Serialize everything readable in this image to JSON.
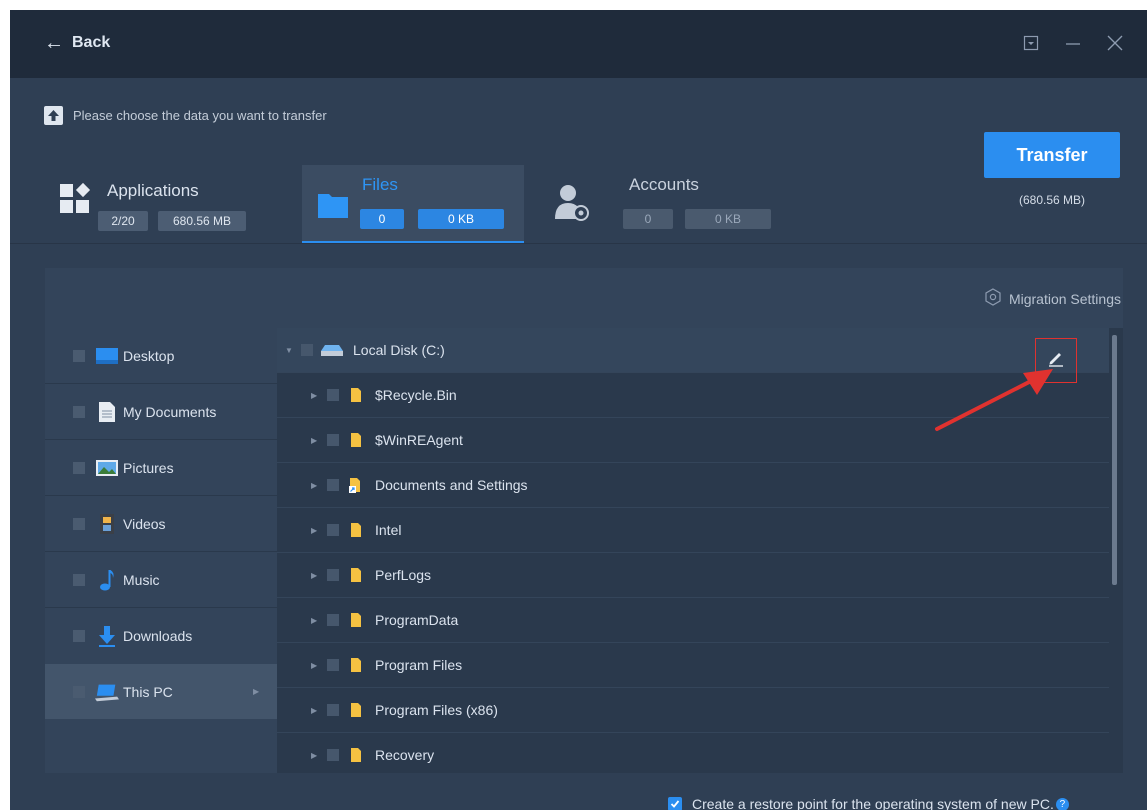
{
  "titlebar": {
    "back_label": "Back"
  },
  "header": {
    "hint": "Please choose the data you want to transfer",
    "tabs": [
      {
        "label": "Applications",
        "count": "2/20",
        "size": "680.56 MB"
      },
      {
        "label": "Files",
        "count": "0",
        "size": "0 KB"
      },
      {
        "label": "Accounts",
        "count": "0",
        "size": "0 KB"
      }
    ],
    "transfer_label": "Transfer",
    "transfer_size": "(680.56 MB)"
  },
  "panel": {
    "migration_settings": "Migration Settings",
    "sidebar": [
      {
        "label": "Desktop",
        "icon": "desktop-icon"
      },
      {
        "label": "My Documents",
        "icon": "documents-icon"
      },
      {
        "label": "Pictures",
        "icon": "pictures-icon"
      },
      {
        "label": "Videos",
        "icon": "videos-icon"
      },
      {
        "label": "Music",
        "icon": "music-icon"
      },
      {
        "label": "Downloads",
        "icon": "downloads-icon"
      },
      {
        "label": "This PC",
        "icon": "this-pc-icon",
        "selected": true
      }
    ],
    "tree": {
      "root": "Local Disk (C:)",
      "folders": [
        "$Recycle.Bin",
        "$WinREAgent",
        "Documents and Settings",
        "Intel",
        "PerfLogs",
        "ProgramData",
        "Program Files",
        "Program Files (x86)",
        "Recovery"
      ]
    }
  },
  "footer": {
    "restore_label": "Create a restore point for the operating system of new PC.",
    "restore_checked": true
  },
  "colors": {
    "accent": "#2b8ef0",
    "window_bg": "#2f3f54",
    "titlebar_bg": "#1f2b3b",
    "folder": "#f5c242",
    "annotation": "#e0322f"
  }
}
